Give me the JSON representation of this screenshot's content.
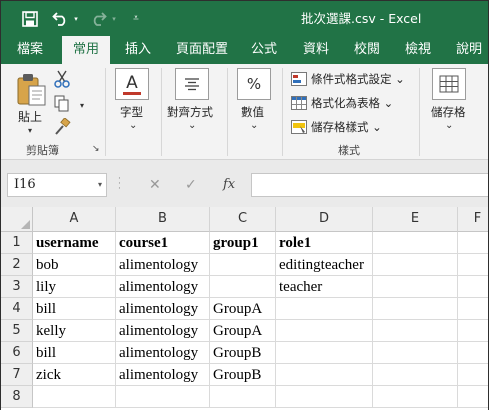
{
  "title_bar": {
    "title": "批次選課.csv - Excel",
    "colors": {
      "brand": "#217346"
    },
    "icons": [
      "save-icon",
      "undo-icon",
      "redo-icon",
      "customize-qat-icon"
    ],
    "undo_dropdown": "▾",
    "redo_dropdown": "▾",
    "customize_glyph": "⩡"
  },
  "ribbon_tabs": [
    "檔案",
    "常用",
    "插入",
    "頁面配置",
    "公式",
    "資料",
    "校閱",
    "檢視",
    "說明"
  ],
  "active_tab": "常用",
  "ribbon": {
    "clipboard": {
      "paste_label": "貼上",
      "paste_arrow": "▾",
      "group_label": "剪貼簿",
      "launcher": "↘"
    },
    "font": {
      "label": "字型",
      "button_glyph": "A",
      "arrow": "⌄"
    },
    "alignment": {
      "label": "對齊方式",
      "arrow": "⌄"
    },
    "number": {
      "label": "數值",
      "button_glyph": "%",
      "arrow": "⌄"
    },
    "styles": {
      "conditional_formatting": "條件式格式設定 ⌄",
      "format_as_table": "格式化為表格 ⌄",
      "cell_styles": "儲存格樣式 ⌄",
      "group_label": "樣式"
    },
    "cells": {
      "label": "儲存格",
      "arrow": "⌄"
    }
  },
  "formula_bar": {
    "name_box": "I16",
    "name_box_arrow": "▾",
    "cancel_glyph": "✕",
    "enter_glyph": "✓",
    "fx_glyph": "fx",
    "formula": ""
  },
  "sheet": {
    "columns": [
      "A",
      "B",
      "C",
      "D",
      "E",
      "F"
    ],
    "row_numbers": [
      "1",
      "2",
      "3",
      "4",
      "5",
      "6",
      "7",
      "8"
    ],
    "rows": [
      [
        "username",
        "course1",
        "group1",
        "role1",
        ""
      ],
      [
        "bob",
        "alimentology",
        "",
        "editingteacher",
        ""
      ],
      [
        "lily",
        "alimentology",
        "",
        "teacher",
        ""
      ],
      [
        "bill",
        "alimentology",
        "GroupA",
        "",
        ""
      ],
      [
        "kelly",
        "alimentology",
        "GroupA",
        "",
        ""
      ],
      [
        "bill",
        "alimentology",
        "GroupB",
        "",
        ""
      ],
      [
        "zick",
        "alimentology",
        "GroupB",
        "",
        ""
      ],
      [
        "",
        "",
        "",
        "",
        ""
      ]
    ]
  }
}
